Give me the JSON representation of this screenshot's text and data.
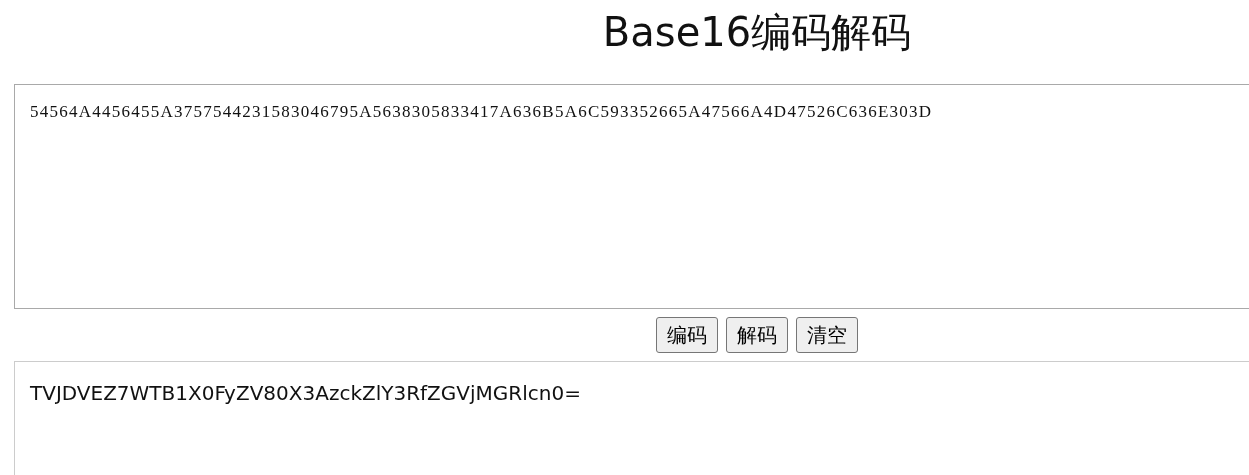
{
  "title": "Base16编码解码",
  "input": {
    "value": "54564A4456455A3757544231583046795A5638305833417A636B5A6C593352665A47566A4D47526C636E303D"
  },
  "buttons": [
    {
      "label": "编码"
    },
    {
      "label": "解码"
    },
    {
      "label": "清空"
    }
  ],
  "output": {
    "value": "TVJDVEZ7WTB1X0FyZV80X3AzckZlY3RfZGVjMGRlcn0="
  }
}
